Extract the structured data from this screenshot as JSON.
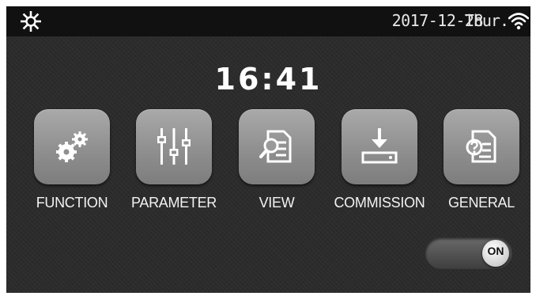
{
  "status_bar": {
    "date": "2017-12-28",
    "weekday": "Thur.",
    "left_icon": "sun-icon",
    "right_icon": "wifi-icon"
  },
  "clock": {
    "time": "16:41"
  },
  "menu": [
    {
      "label": "FUNCTION",
      "icon": "gears-icon"
    },
    {
      "label": "PARAMETER",
      "icon": "sliders-icon"
    },
    {
      "label": "VIEW",
      "icon": "document-search-icon"
    },
    {
      "label": "COMMISSION",
      "icon": "download-icon"
    },
    {
      "label": "GENERAL",
      "icon": "document-help-icon"
    }
  ],
  "toggle": {
    "label": "ON",
    "state": "on"
  },
  "colors": {
    "background": "#2b2b2b",
    "status_bar": "#111111",
    "tile": "#9a9a9a",
    "text": "#ffffff"
  }
}
